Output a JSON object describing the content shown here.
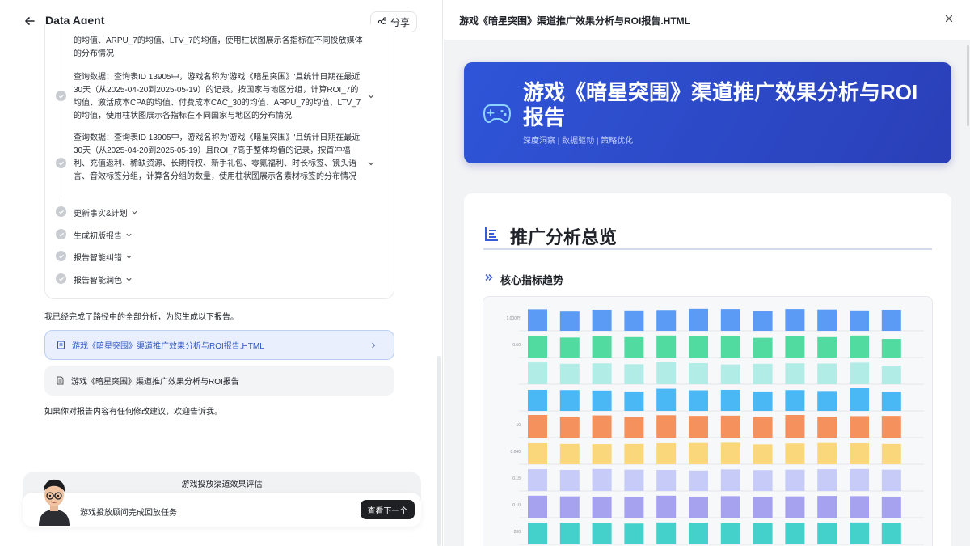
{
  "left_panel": {
    "app_title": "Data Agent",
    "share_label": "分享",
    "steps": [
      {
        "text_top": "的均值、ARPU_7的均值、LTV_7的均值，使用柱状图展示各指标在不同投放媒体的分布情况"
      },
      {
        "text": "查询数据：查询表ID 13905中，游戏名称为'游戏《暗星突围》'且统计日期在最近30天（从2025-04-20到2025-05-19）的记录，按国家与地区分组，计算ROI_7的均值、激活成本CPA的均值、付费成本CAC_30的均值、ARPU_7的均值、LTV_7的均值，使用柱状图展示各指标在不同国家与地区的分布情况"
      },
      {
        "text": "查询数据：查询表ID 13905中，游戏名称为'游戏《暗星突围》'且统计日期在最近30天（从2025-04-20到2025-05-19）且ROI_7高于整体均值的记录，按首冲福利、充值返利、稀缺资源、长期特权、新手礼包、零氪福利、时长标签、镜头语言、音效标签分组，计算各分组的数量，使用柱状图展示各素材标签的分布情况"
      }
    ],
    "sub_steps": [
      "更新事实&计划",
      "生成初版报告",
      "报告智能纠错",
      "报告智能润色"
    ],
    "done_message": "我已经完成了路径中的全部分析，为您生成以下报告。",
    "report_link_label": "游戏《暗星突围》渠道推广效果分析与ROI报告.HTML",
    "report_file_label": "游戏《暗星突围》渠道推广效果分析与ROI报告",
    "followup_message": "如果你对报告内容有任何修改建议，欢迎告诉我。",
    "task": {
      "title": "游戏投放渠道效果评估",
      "text": "游戏投放顾问完成回放任务",
      "next_label": "查看下一个"
    }
  },
  "right_panel": {
    "doc_title": "游戏《暗星突围》渠道推广效果分析与ROI报告.HTML",
    "banner_title": "游戏《暗星突围》渠道推广效果分析与ROI报告",
    "banner_subtitle": "深度洞察 | 数据驱动 | 策略优化",
    "section_title": "推广分析总览",
    "subsection_title": "核心指标趋势"
  },
  "chart_data": {
    "type": "bar",
    "title": "",
    "rows": [
      {
        "tick": "1,000万",
        "color": "#5b9bf5",
        "values": [
          0.95,
          0.85,
          0.93,
          0.9,
          0.92,
          0.97,
          0.96,
          0.88,
          0.96,
          0.94,
          0.9,
          0.93
        ]
      },
      {
        "tick": "0.50",
        "color": "#52dba0",
        "values": [
          0.95,
          0.88,
          0.93,
          0.9,
          0.97,
          0.93,
          0.95,
          0.87,
          0.96,
          0.9,
          0.97,
          0.82
        ]
      },
      {
        "tick": "",
        "color": "#b2ece6",
        "values": [
          0.96,
          0.9,
          0.92,
          0.88,
          0.97,
          0.93,
          0.87,
          0.9,
          0.92,
          0.91,
          0.95,
          0.82
        ]
      },
      {
        "tick": "",
        "color": "#49b8f5",
        "values": [
          0.93,
          0.92,
          0.9,
          0.86,
          0.98,
          0.91,
          0.93,
          0.86,
          0.92,
          0.88,
          1.0,
          0.84
        ]
      },
      {
        "tick": "10",
        "color": "#f5915d",
        "values": [
          1.0,
          0.9,
          0.98,
          0.91,
          0.99,
          0.96,
          0.97,
          0.9,
          1.0,
          0.92,
          0.95,
          0.96
        ]
      },
      {
        "tick": "0.040",
        "color": "#fad77a",
        "values": [
          0.93,
          0.9,
          0.89,
          0.9,
          0.93,
          0.94,
          0.95,
          0.88,
          0.92,
          0.94,
          0.93,
          0.9
        ]
      },
      {
        "tick": "0.15",
        "color": "#c6cbf7",
        "values": [
          0.96,
          0.93,
          0.97,
          0.94,
          0.93,
          0.9,
          0.95,
          0.92,
          0.94,
          0.96,
          0.97,
          0.94
        ]
      },
      {
        "tick": "0.10",
        "color": "#a6a2f0",
        "values": [
          0.97,
          0.94,
          0.93,
          0.92,
          0.97,
          0.93,
          0.95,
          0.92,
          0.94,
          0.96,
          0.95,
          0.93
        ]
      },
      {
        "tick": "200",
        "color": "#44d0cb",
        "values": [
          0.96,
          0.95,
          0.94,
          0.92,
          0.97,
          0.95,
          0.93,
          0.94,
          0.95,
          0.96,
          0.97,
          0.95
        ]
      }
    ]
  },
  "colors": {
    "banner_blue": "#2f55d8",
    "link_blue": "#2a55c4",
    "link_bg": "#e9effd"
  }
}
